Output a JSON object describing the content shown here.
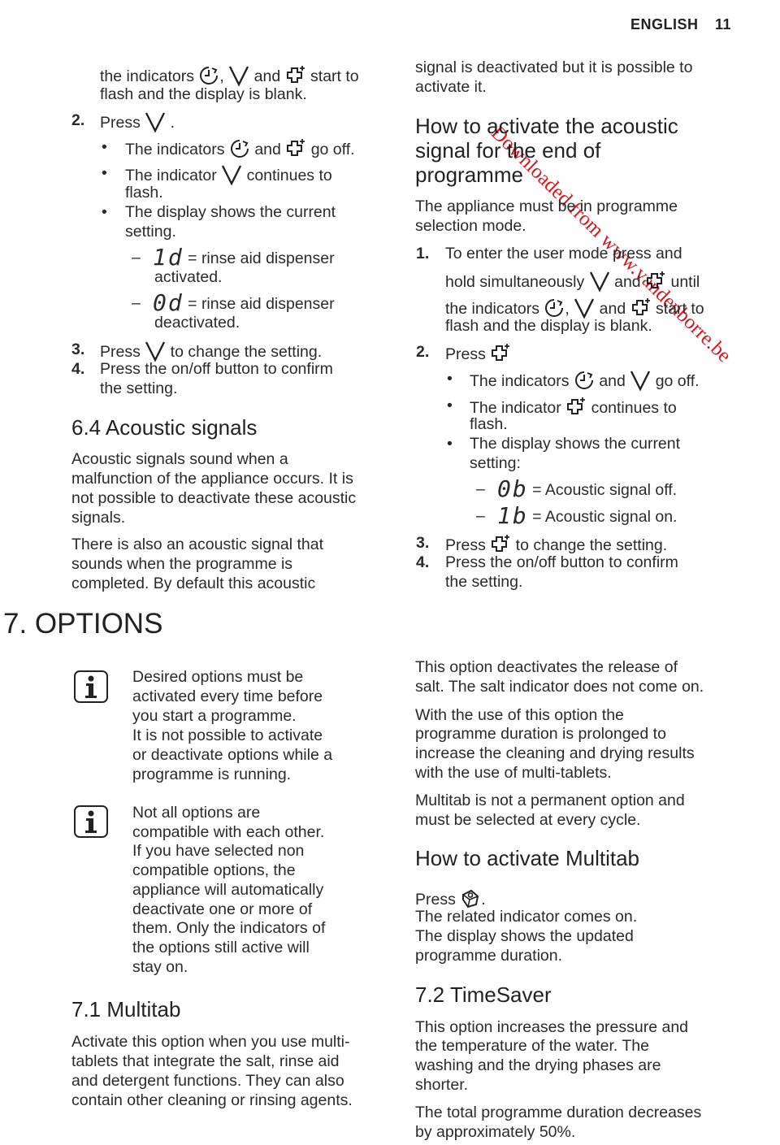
{
  "header": {
    "language": "ENGLISH",
    "page_number": "11"
  },
  "watermark": "Downloaded from www.vandenborre.be",
  "icons": [
    "timer-icon",
    "v-down-icon",
    "plus-program-icon",
    "multitab-icon",
    "info-icon"
  ],
  "left": {
    "l1": [
      "the indicators ",
      ",",
      " and ",
      " start to"
    ],
    "l2": "flash and the display is blank.",
    "s2": {
      "num": "2.",
      "a": "Press ",
      "b": " ."
    },
    "b1": [
      "The indicators ",
      " and ",
      " go off."
    ],
    "b2a": [
      "The indicator ",
      " continues to"
    ],
    "b2b": "flash.",
    "b3a": "The display shows the current",
    "b3b": "setting.",
    "d1": {
      "code": "1d",
      "a": " = rinse aid dispenser",
      "b": "activated."
    },
    "d2": {
      "code": "0d",
      "a": " = rinse aid dispenser",
      "b": "deactivated."
    },
    "s3": {
      "num": "3.",
      "a": "Press ",
      "b": " to change the setting."
    },
    "s4": {
      "num": "4.",
      "a": "Press the on/off button to confirm",
      "b": "the setting."
    },
    "h64": "6.4 Acoustic signals",
    "p1": [
      "Acoustic signals sound when a",
      "malfunction of the appliance occurs. It is",
      "not possible to deactivate these acoustic",
      "signals."
    ],
    "p2": [
      "There is also an acoustic signal that",
      "sounds when the programme is",
      "completed. By default this acoustic"
    ],
    "h7": "7. OPTIONS",
    "info1": [
      "Desired options must be",
      "activated every time before",
      "you start a programme.",
      "It is not possible to activate",
      "or deactivate options while a",
      "programme is running."
    ],
    "info2": [
      "Not all options are",
      "compatible with each other.",
      "If you have selected non",
      "compatible options, the",
      "appliance will automatically",
      "deactivate one or more of",
      "them. Only the indicators of",
      "the options still active will",
      "stay on."
    ],
    "h71": "7.1 Multitab",
    "p3": [
      "Activate this option when you use multi-",
      "tablets that integrate the salt, rinse aid",
      "and detergent functions. They can also",
      "contain other cleaning or rinsing agents."
    ]
  },
  "right": {
    "p0": [
      "signal is deactivated but it is possible to",
      "activate it."
    ],
    "h": [
      "How to activate the acoustic",
      "signal for the end of",
      "programme"
    ],
    "p1": [
      "The appliance must be in programme",
      "selection mode."
    ],
    "s1": {
      "num": "1.",
      "a": "To enter the user mode press and",
      "b": [
        "hold simultaneously ",
        " and ",
        " until"
      ],
      "c": [
        "the indicators ",
        ",",
        " and ",
        " start to"
      ],
      "d": "flash and the display is blank."
    },
    "s2": {
      "num": "2.",
      "a": "Press "
    },
    "b1": [
      "The indicators ",
      " and ",
      " go off."
    ],
    "b2": [
      "The indicator ",
      " continues to"
    ],
    "b2b": "flash.",
    "b3a": "The display shows the current",
    "b3b": "setting:",
    "d1": {
      "code": "0b",
      "a": " = Acoustic signal off."
    },
    "d2": {
      "code": "1b",
      "a": " = Acoustic signal on."
    },
    "s3": {
      "num": "3.",
      "a": "Press ",
      "b": " to change the setting."
    },
    "s4": {
      "num": "4.",
      "a": "Press the on/off button to confirm",
      "b": "the setting."
    },
    "p2": [
      "This option deactivates the release of",
      "salt. The salt indicator does not come on."
    ],
    "p3": [
      "With the use of this option the",
      "programme duration is prolonged to",
      "increase the cleaning and drying results",
      "with the use of multi-tablets."
    ],
    "p4": [
      "Multitab is not a permanent option and",
      "must be selected at every cycle."
    ],
    "hm": "How to activate Multitab",
    "press": [
      "Press ",
      "."
    ],
    "p5": [
      "The related indicator comes on.",
      "The display shows the updated",
      "programme duration."
    ],
    "h72": "7.2 TimeSaver",
    "p6": [
      "This option increases the pressure and",
      "the temperature of the water. The",
      "washing and the drying phases are",
      "shorter."
    ],
    "p7": [
      "The total programme duration decreases",
      "by approximately 50%."
    ]
  }
}
